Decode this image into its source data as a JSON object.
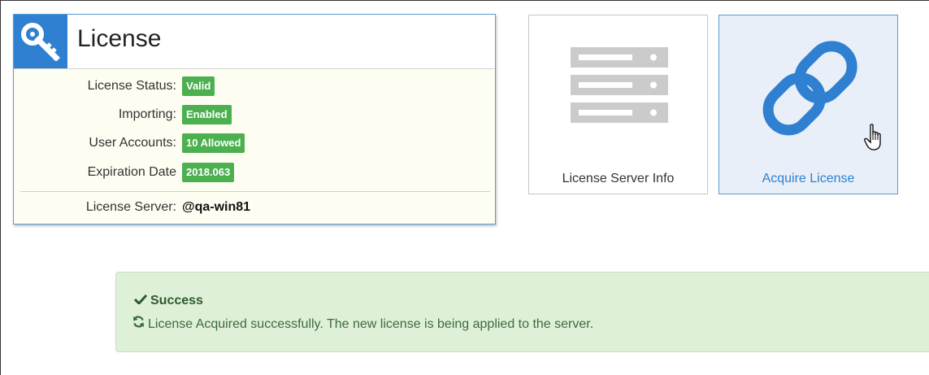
{
  "license": {
    "title": "License",
    "rows": [
      {
        "label": "License Status:",
        "value": "Valid"
      },
      {
        "label": "Importing:",
        "value": "Enabled"
      },
      {
        "label": "User Accounts:",
        "value": "10 Allowed"
      },
      {
        "label": "Expiration Date",
        "value": "2018.063"
      }
    ],
    "server_label": "License Server:",
    "server_value": "@qa-win81"
  },
  "tiles": {
    "server_info": {
      "label": "License Server Info",
      "icon": "server-icon"
    },
    "acquire": {
      "label": "Acquire License",
      "icon": "chain-link-icon"
    }
  },
  "alert": {
    "title": "Success",
    "message": "License Acquired successfully. The new license is being applied to the server."
  },
  "colors": {
    "accent": "#2f80d0",
    "badge": "#4caf50",
    "alert_bg": "#dff0d8",
    "alert_text": "#3c6b3c"
  }
}
